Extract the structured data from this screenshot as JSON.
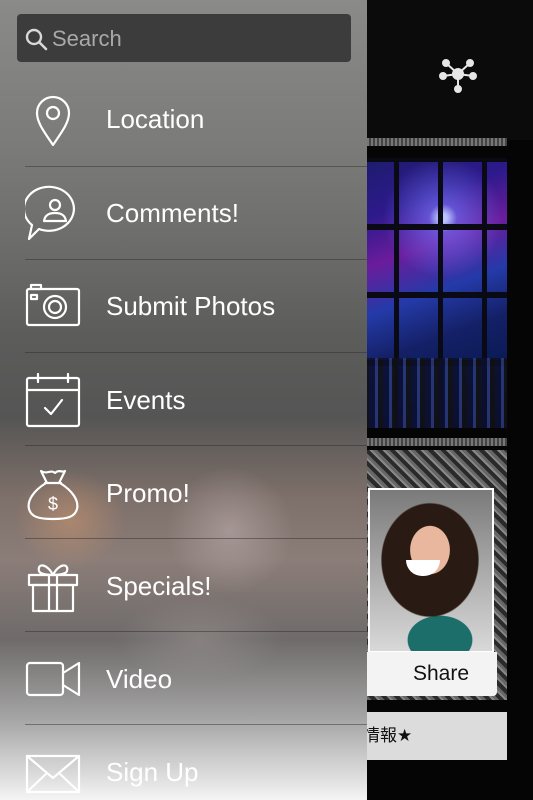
{
  "search": {
    "placeholder": "Search",
    "value": ""
  },
  "menu": {
    "items": [
      {
        "label": "Location",
        "icon": "location-pin-icon"
      },
      {
        "label": "Comments!",
        "icon": "comment-user-icon"
      },
      {
        "label": "Submit Photos",
        "icon": "camera-icon"
      },
      {
        "label": "Events",
        "icon": "calendar-check-icon"
      },
      {
        "label": "Promo!",
        "icon": "money-bag-icon"
      },
      {
        "label": "Specials!",
        "icon": "gift-icon"
      },
      {
        "label": "Video",
        "icon": "video-camera-icon"
      },
      {
        "label": "Sign Up",
        "icon": "envelope-icon"
      }
    ]
  },
  "background": {
    "share_label": "Share",
    "info_text": "情報★",
    "header_icon": "network-share-icon"
  },
  "colors": {
    "search_bg": "#3c3c3c",
    "menu_text": "#ffffff"
  }
}
